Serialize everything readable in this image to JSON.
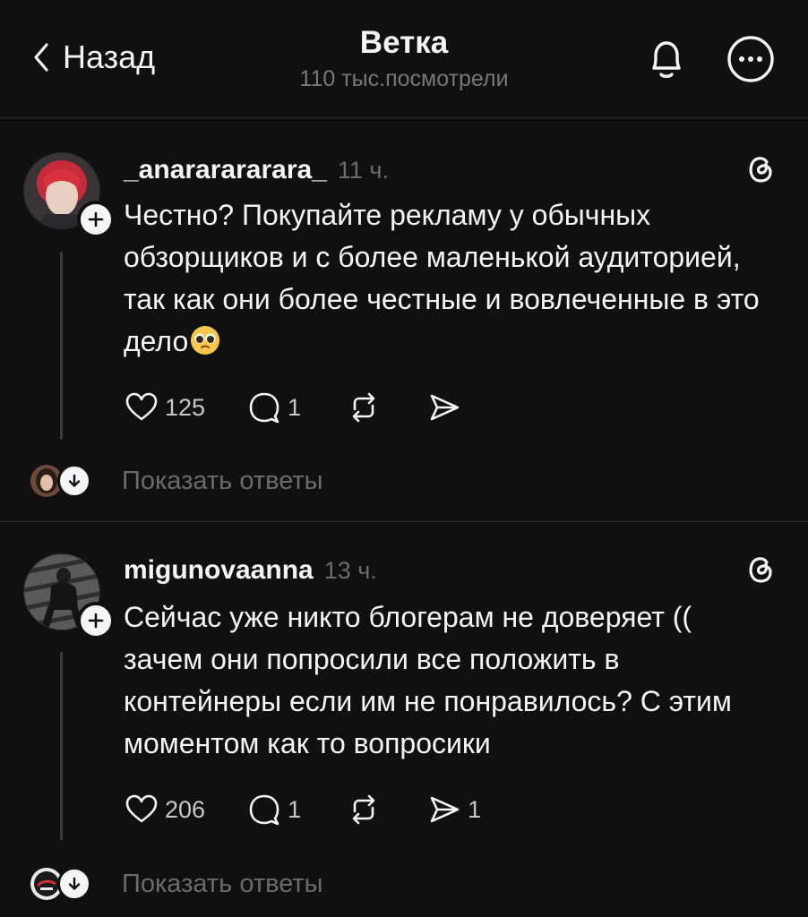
{
  "header": {
    "back_label": "Назад",
    "title": "Ветка",
    "subtitle": "110 тыс.посмотрели",
    "icons": [
      "chevron-left-icon",
      "bell-icon",
      "more-icon"
    ]
  },
  "posts": [
    {
      "username": "_anararararara_",
      "time": "11 ч.",
      "text": "Честно? Покупайте рекламу у обычных обзорщиков и с более маленькой аудиторией, так как они более честные и вовлеченные в это дело",
      "emoji": "pleading-face-emoji",
      "likes": "125",
      "comments": "1",
      "reposts": "",
      "shares": "",
      "show_replies": "Показать ответы"
    },
    {
      "username": "migunovaanna",
      "time": "13 ч.",
      "text": "Сейчас уже никто блогерам не доверяет (( зачем они попросили все положить в контейнеры если им не понравилось? С этим моментом как то вопросики",
      "likes": "206",
      "comments": "1",
      "reposts": "",
      "shares": "1",
      "show_replies": "Показать ответы"
    }
  ],
  "colors": {
    "background": "#101010",
    "text": "#f3f5f7",
    "muted": "#6b6b6b",
    "divider": "#2b2b2b"
  }
}
